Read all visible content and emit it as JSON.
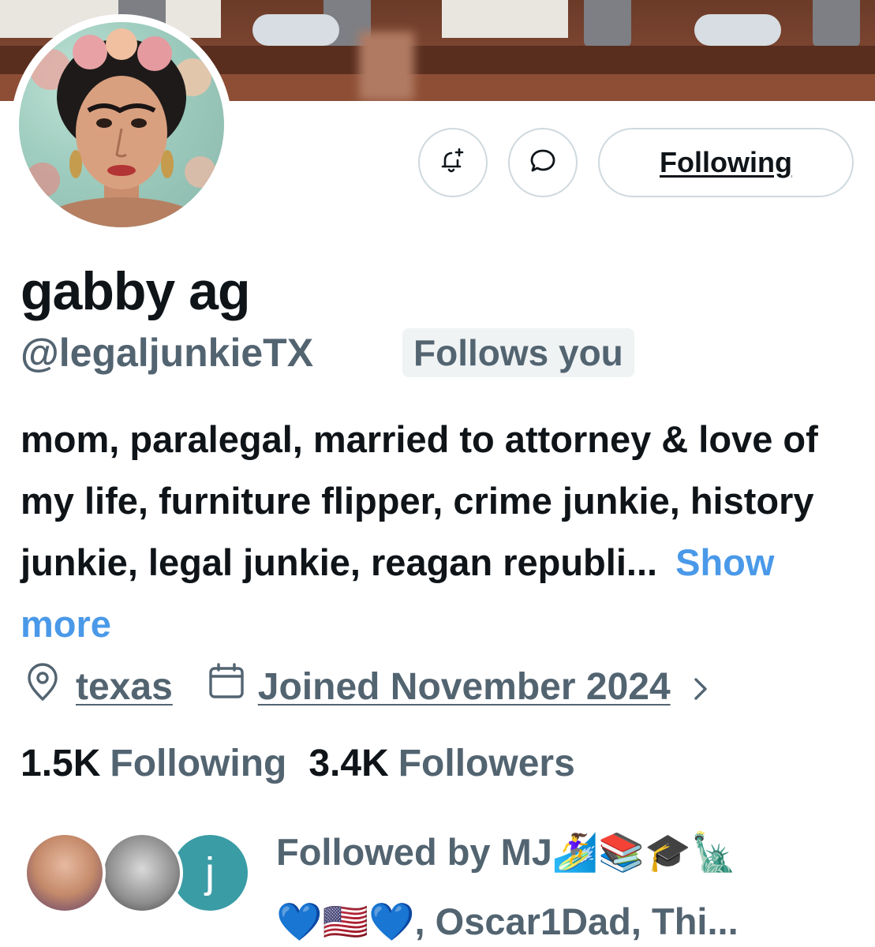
{
  "profile": {
    "display_name": "gabby ag",
    "handle": "@legaljunkieTX",
    "follows_you_badge": "Follows you",
    "bio": "mom, paralegal, married to attorney & love of my life, furniture flipper, crime junkie, history junkie, legal junkie, reagan republi...",
    "show_more": "Show more",
    "location": "texas",
    "joined": "Joined November 2024"
  },
  "actions": {
    "following_label": "Following"
  },
  "stats": {
    "following_count": "1.5K",
    "following_label": "Following",
    "followers_count": "3.4K",
    "followers_label": "Followers"
  },
  "followed_by": {
    "text_line1": "Followed by MJ🏄‍♀️📚🎓🗽",
    "text_line2": "💙🇺🇸💙, Oscar1Dad, Thi...",
    "third_avatar_letter": "j"
  },
  "colors": {
    "primary_text": "#0f1419",
    "secondary_text": "#536471",
    "link_blue": "#4a99e9",
    "border": "#cfd9de",
    "badge_bg": "#eff3f4"
  },
  "icons": [
    "bell-plus-icon",
    "message-icon",
    "location-pin-icon",
    "calendar-icon",
    "chevron-right-icon"
  ]
}
